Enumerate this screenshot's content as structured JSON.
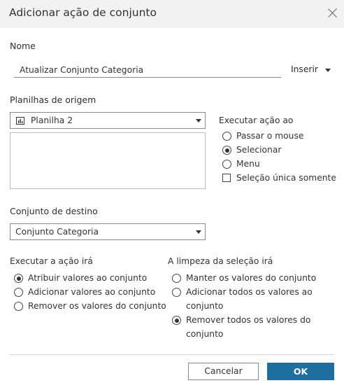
{
  "dialog": {
    "title": "Adicionar ação de conjunto"
  },
  "name_section": {
    "label": "Nome",
    "value": "Atualizar Conjunto Categoria",
    "insert_label": "Inserir"
  },
  "source_sheets": {
    "label": "Planilhas de origem",
    "selected": "Planilha 2"
  },
  "run_action_on": {
    "label": "Executar ação ao",
    "options": [
      {
        "label": "Passar o mouse",
        "checked": false
      },
      {
        "label": "Selecionar",
        "checked": true
      },
      {
        "label": "Menu",
        "checked": false
      }
    ],
    "single_select_label": "Seleção única somente",
    "single_select_checked": false
  },
  "target_set": {
    "label": "Conjunto de destino",
    "selected": "Conjunto Categoria"
  },
  "running_action": {
    "label": "Executar a ação irá",
    "options": [
      {
        "label": "Atribuir valores ao conjunto",
        "checked": true
      },
      {
        "label": "Adicionar valores ao conjunto",
        "checked": false
      },
      {
        "label": "Remover os valores do conjunto",
        "checked": false
      }
    ]
  },
  "clearing_selection": {
    "label": "A limpeza da seleção irá",
    "options": [
      {
        "line1": "Manter os valores do conjunto",
        "line2": "",
        "checked": false
      },
      {
        "line1": "Adicionar todos os valores ao",
        "line2": "conjunto",
        "checked": false
      },
      {
        "line1": "Remover todos os valores do",
        "line2": "conjunto",
        "checked": true
      }
    ]
  },
  "buttons": {
    "cancel": "Cancelar",
    "ok": "OK"
  }
}
